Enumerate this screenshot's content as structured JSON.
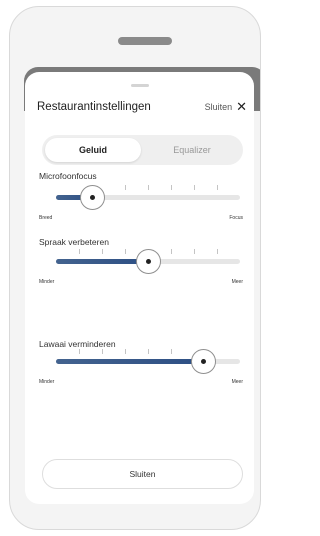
{
  "sheet": {
    "title": "Restaurantinstellingen",
    "close_label": "Sluiten",
    "close_icon": "x-icon"
  },
  "tabs": [
    {
      "label": "Geluid",
      "active": true
    },
    {
      "label": "Equalizer",
      "active": false
    }
  ],
  "controls": [
    {
      "label": "Microfoonfocus",
      "min_label": "Breed",
      "max_label": "Focus",
      "value": 0.2
    },
    {
      "label": "Spraak verbeteren",
      "min_label": "Minder",
      "max_label": "Meer",
      "value": 0.5
    },
    {
      "label": "Lawaai verminderen",
      "min_label": "Minder",
      "max_label": "Meer",
      "value": 0.8
    }
  ],
  "footer": {
    "close_button_label": "Sluiten"
  },
  "colors": {
    "accent": "#2d4f84",
    "track": "#e6e6e6"
  }
}
